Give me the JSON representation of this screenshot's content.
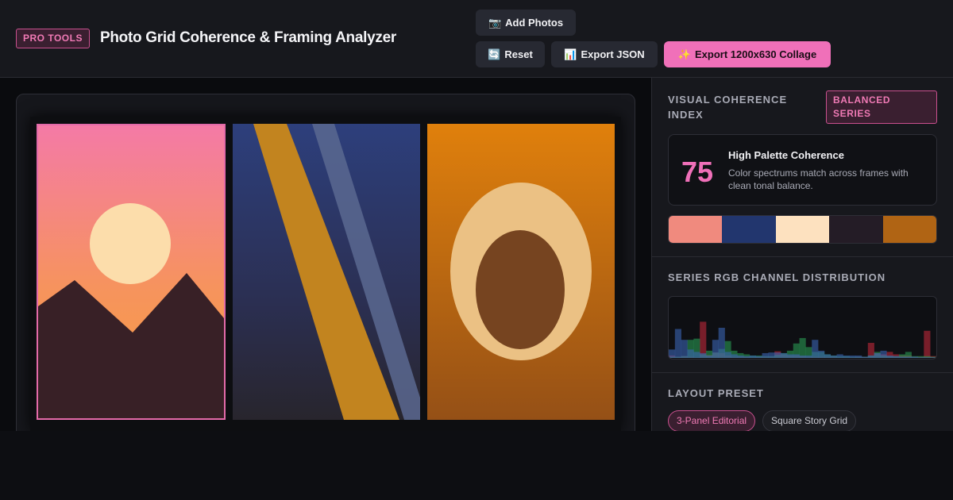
{
  "header": {
    "badge": "PRO TOOLS",
    "title": "Photo Grid Coherence & Framing Analyzer",
    "buttons": {
      "add_photos": {
        "icon": "📷",
        "label": "Add Photos"
      },
      "reset": {
        "icon": "🔄",
        "label": "Reset"
      },
      "export_json": {
        "icon": "📊",
        "label": "Export JSON"
      },
      "export_collage": {
        "icon": "✨",
        "label": "Export 1200x630 Collage"
      }
    }
  },
  "collage": {
    "panels": [
      {
        "name": "sunset-mountain",
        "selected": true
      },
      {
        "name": "diagonal-stripes",
        "selected": false
      },
      {
        "name": "orange-ring",
        "selected": false
      }
    ]
  },
  "coherence": {
    "title": "VISUAL COHERENCE INDEX",
    "badge": "BALANCED SERIES",
    "score": "75",
    "label": "High Palette Coherence",
    "description": "Color spectrums match across frames with clean tonal balance.",
    "palette": [
      "#f08a7e",
      "#22366e",
      "#fde1bf",
      "#241c26",
      "#b06414"
    ]
  },
  "rgb": {
    "title": "SERIES RGB CHANNEL DISTRIBUTION",
    "channels": {
      "red": [
        4,
        2,
        3,
        2,
        1,
        60,
        5,
        9,
        8,
        4,
        2,
        2,
        2,
        1,
        2,
        2,
        2,
        11,
        6,
        4,
        4,
        3,
        2,
        2,
        2,
        2,
        2,
        1,
        1,
        1,
        2,
        2,
        25,
        8,
        6,
        10,
        6,
        4,
        4,
        2,
        2,
        45,
        3
      ],
      "green": [
        2,
        2,
        3,
        30,
        32,
        6,
        12,
        9,
        15,
        28,
        12,
        8,
        6,
        4,
        4,
        3,
        3,
        5,
        8,
        12,
        24,
        33,
        18,
        10,
        10,
        6,
        4,
        3,
        3,
        2,
        2,
        2,
        4,
        10,
        4,
        3,
        3,
        6,
        10,
        3,
        3,
        3,
        2
      ],
      "blue": [
        14,
        48,
        30,
        14,
        10,
        8,
        4,
        30,
        50,
        10,
        6,
        4,
        3,
        4,
        3,
        8,
        9,
        9,
        8,
        6,
        6,
        4,
        4,
        30,
        12,
        6,
        4,
        6,
        4,
        4,
        4,
        2,
        4,
        8,
        12,
        4,
        3,
        2,
        2,
        2,
        1,
        1,
        1
      ]
    }
  },
  "layout": {
    "title": "LAYOUT PRESET",
    "presets": [
      {
        "label": "3-Panel Editorial",
        "active": true
      },
      {
        "label": "Square Story Grid",
        "active": false
      }
    ]
  },
  "colors": {
    "accent": "#f070b9",
    "red_channel": "#c0283a",
    "green_channel": "#2a9a54",
    "blue_channel": "#3a64b4"
  }
}
